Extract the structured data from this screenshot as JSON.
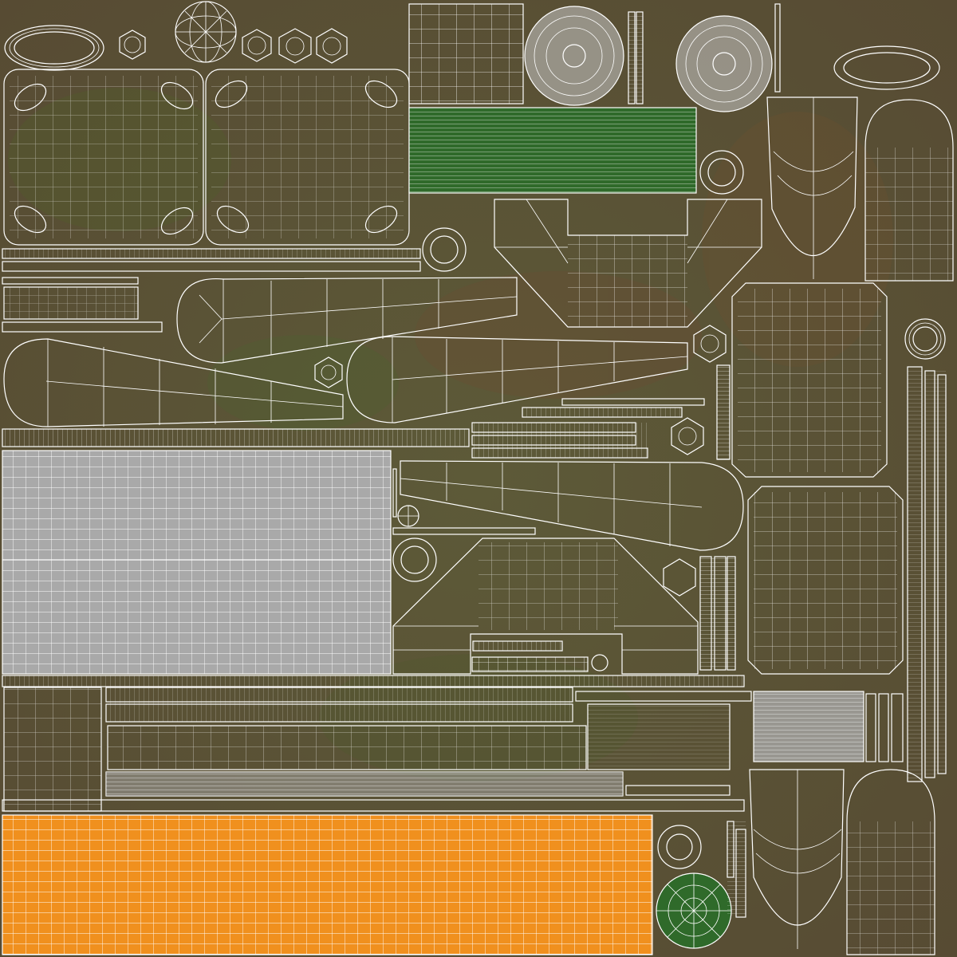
{
  "colors": {
    "background": "#5b5135",
    "background_tint": "#4f5a2e",
    "wireframe": "#ffffff",
    "grey_patch": "#a9a9a9",
    "orange_patch": "#f0901e",
    "green_patch": "#2f6a2a",
    "disc_patch": "#c8c8c8"
  },
  "icons": [
    "uv-wireframe-shell",
    "hexagon-nut-icon",
    "washer-ring-icon",
    "disc-icon",
    "sphere-icon"
  ]
}
